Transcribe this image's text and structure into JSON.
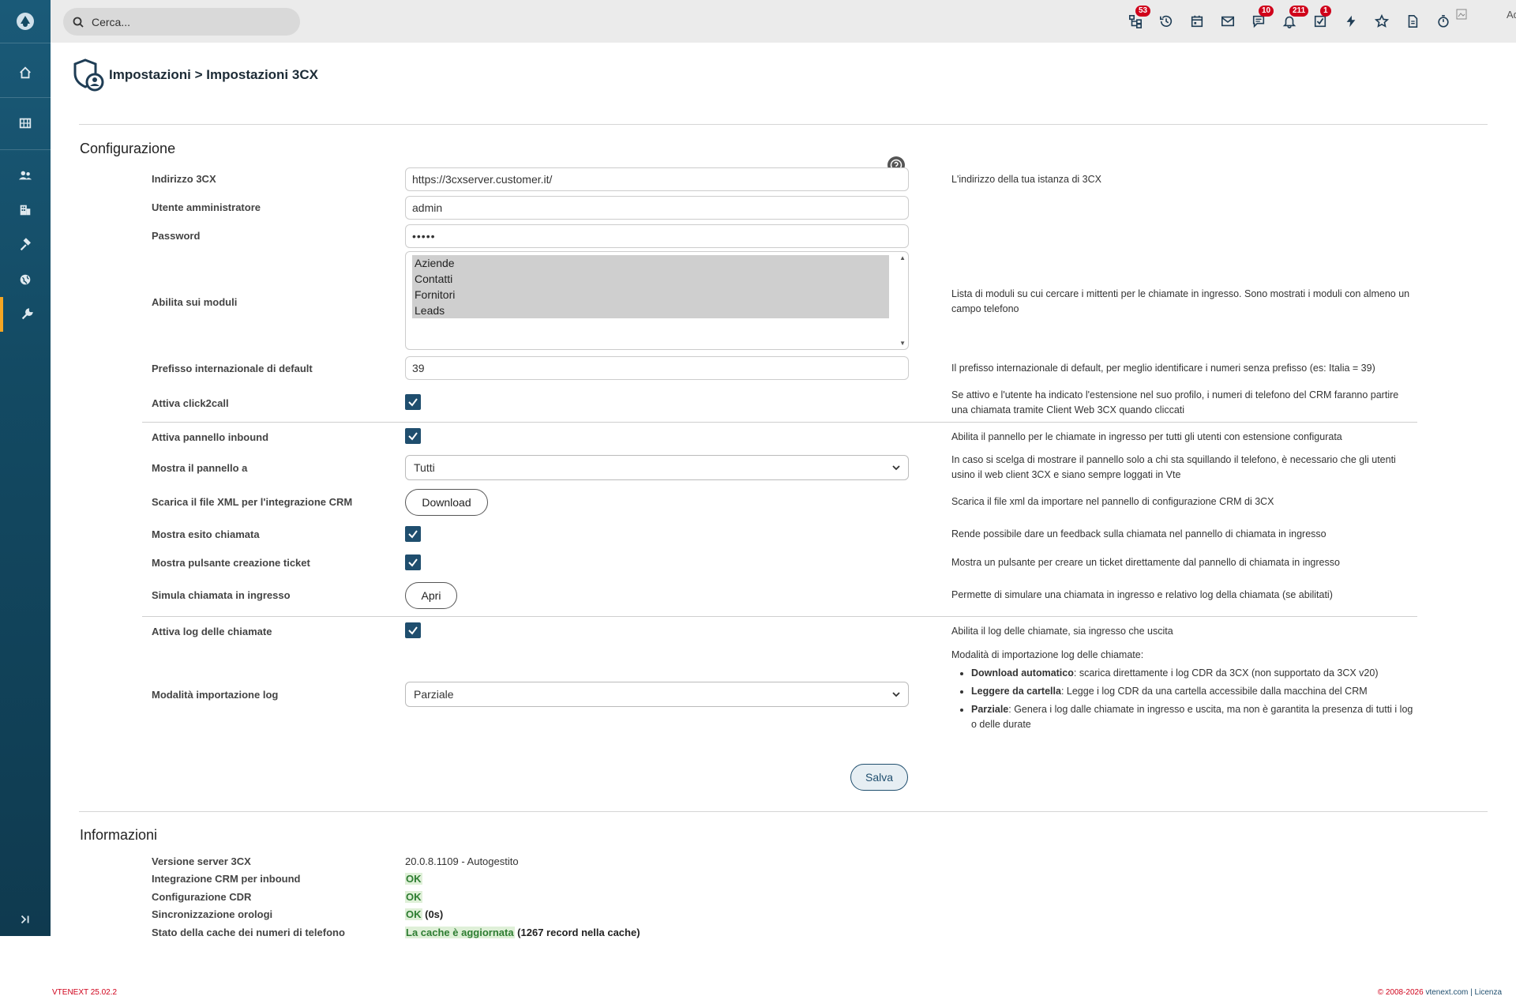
{
  "topbar": {
    "search_placeholder": "Cerca...",
    "badges": {
      "tree": "53",
      "chat": "10",
      "bell": "211",
      "tasks": "1"
    },
    "user_label": "Administrator"
  },
  "header": {
    "title": "Impostazioni > Impostazioni 3CX"
  },
  "config": {
    "title": "Configurazione",
    "address": {
      "label": "Indirizzo 3CX",
      "value": "https://3cxserver.customer.it/",
      "desc": "L'indirizzo della tua istanza di 3CX"
    },
    "admin_user": {
      "label": "Utente amministratore",
      "value": "admin"
    },
    "password": {
      "label": "Password",
      "value": "•••••"
    },
    "modules": {
      "label": "Abilita sui moduli",
      "options": [
        "Aziende",
        "Contatti",
        "Fornitori",
        "Leads"
      ],
      "desc": "Lista di moduli su cui cercare i mittenti per le chiamate in ingresso. Sono mostrati i moduli con almeno un campo telefono"
    },
    "prefix": {
      "label": "Prefisso internazionale di default",
      "value": "39",
      "desc": "Il prefisso internazionale di default, per meglio identificare i numeri senza prefisso (es: Italia = 39)"
    },
    "click2call": {
      "label": "Attiva click2call",
      "desc": "Se attivo e l'utente ha indicato l'estensione nel suo profilo, i numeri di telefono del CRM faranno partire una chiamata tramite Client Web 3CX quando cliccati"
    },
    "inbound_panel": {
      "label": "Attiva pannello inbound",
      "desc": "Abilita il pannello per le chiamate in ingresso per tutti gli utenti con estensione configurata"
    },
    "show_panel": {
      "label": "Mostra il pannello a",
      "value": "Tutti",
      "desc": "In caso si scelga di mostrare il pannello solo a chi sta squillando il telefono, è necessario che gli utenti usino il web client 3CX e siano sempre loggati in Vte"
    },
    "xml": {
      "label": "Scarica il file XML per l'integrazione CRM",
      "button": "Download",
      "desc": "Scarica il file xml da importare nel pannello di configurazione CRM di 3CX"
    },
    "outcome": {
      "label": "Mostra esito chiamata",
      "desc": "Rende possibile dare un feedback sulla chiamata nel pannello di chiamata in ingresso"
    },
    "ticket": {
      "label": "Mostra pulsante creazione ticket",
      "desc": "Mostra un pulsante per creare un ticket direttamente dal pannello di chiamata in ingresso"
    },
    "simulate": {
      "label": "Simula chiamata in ingresso",
      "button": "Apri",
      "desc": "Permette di simulare una chiamata in ingresso e relativo log della chiamata (se abilitati)"
    },
    "call_log": {
      "label": "Attiva log delle chiamate",
      "desc": "Abilita il log delle chiamate, sia ingresso che uscita"
    },
    "log_import": {
      "label": "Modalità importazione log",
      "value": "Parziale",
      "intro": "Modalità di importazione log delle chiamate:",
      "modes": [
        {
          "name": "Download automatico",
          "text": ": scarica direttamente i log CDR da 3CX (non supportato da 3CX v20)"
        },
        {
          "name": "Leggere da cartella",
          "text": ": Legge i log CDR da una cartella accessibile dalla macchina del CRM"
        },
        {
          "name": "Parziale",
          "text": ": Genera i log dalle chiamate in ingresso e uscita, ma non è garantita la presenza di tutti i log o delle durate"
        }
      ]
    },
    "save": "Salva"
  },
  "info": {
    "title": "Informazioni",
    "server_version": {
      "label": "Versione server 3CX",
      "value": "20.0.8.1109 - Autogestito"
    },
    "crm_inbound": {
      "label": "Integrazione CRM per inbound",
      "value": "OK"
    },
    "cdr": {
      "label": "Configurazione CDR",
      "value": "OK"
    },
    "clock": {
      "label": "Sincronizzazione orologi",
      "value": "OK",
      "extra": " (0s)"
    },
    "cache": {
      "label": "Stato della cache dei numeri di telefono",
      "value": "La cache è aggiornata",
      "extra": " (1267 record nella cache)"
    }
  },
  "footer": {
    "version": "VTENEXT 25.02.2",
    "copyright": "© 2008-2026 ",
    "site": "vtenext.com",
    "sep": " | ",
    "license": "Licenza"
  },
  "colors": {
    "sidebar": "#134a63",
    "accent": "#f5a623",
    "badge": "#d0021b",
    "checkbox": "#1f4e6e",
    "ok_bg": "#dff0d8"
  }
}
